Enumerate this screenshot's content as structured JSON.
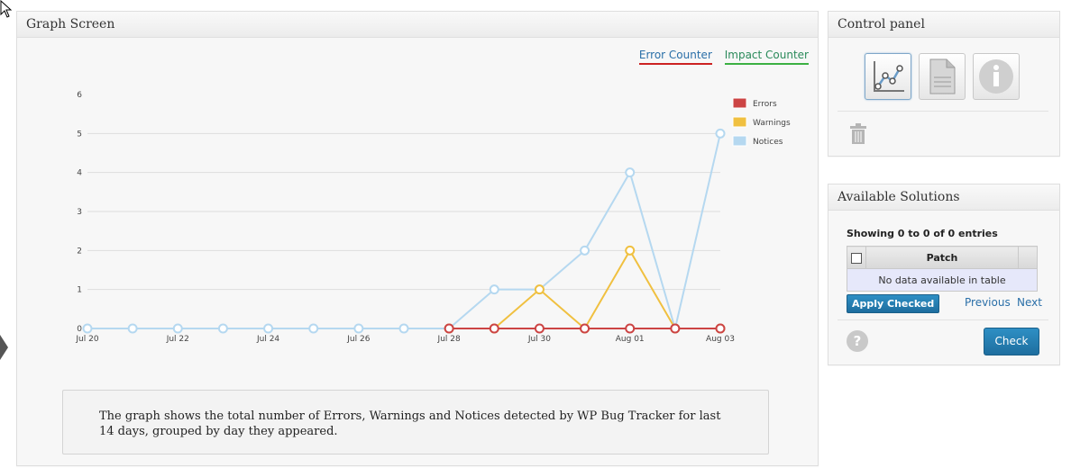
{
  "graph_panel": {
    "title": "Graph Screen",
    "tabs": {
      "error_counter": "Error Counter",
      "impact_counter": "Impact Counter"
    },
    "description": "The graph shows the total number of Errors, Warnings and Notices detected by WP Bug Tracker for last 14 days, grouped by day they appeared."
  },
  "control_panel": {
    "title": "Control panel",
    "icons": [
      "line-chart-icon",
      "document-icon",
      "info-icon",
      "trash-icon"
    ]
  },
  "solutions": {
    "title": "Available Solutions",
    "showing": "Showing 0 to 0 of 0 entries",
    "column": "Patch",
    "empty": "No data available in table",
    "apply": "Apply Checked",
    "previous": "Previous",
    "next": "Next",
    "check": "Check",
    "help_icon": "?"
  },
  "chart_data": {
    "type": "line",
    "x": [
      "Jul 20",
      "Jul 21",
      "Jul 22",
      "Jul 23",
      "Jul 24",
      "Jul 25",
      "Jul 26",
      "Jul 27",
      "Jul 28",
      "Jul 29",
      "Jul 30",
      "Jul 31",
      "Aug 01",
      "Aug 02",
      "Aug 03"
    ],
    "tick_labels": [
      "Jul 20",
      "Jul 22",
      "Jul 24",
      "Jul 26",
      "Jul 28",
      "Jul 30",
      "Aug 01",
      "Aug 03"
    ],
    "y_ticks": [
      0,
      1,
      2,
      3,
      4,
      5,
      6
    ],
    "ylim": [
      0,
      6
    ],
    "grid": true,
    "legend_position": "top-right",
    "series": [
      {
        "name": "Notices",
        "color": "#b5d8f0",
        "start": 0,
        "values": [
          0,
          0,
          0,
          0,
          0,
          0,
          0,
          0,
          0,
          1,
          1,
          2,
          4,
          0,
          5
        ]
      },
      {
        "name": "Warnings",
        "color": "#f0c040",
        "start": 8,
        "values": [
          0,
          0,
          1,
          0,
          2,
          0,
          0
        ]
      },
      {
        "name": "Errors",
        "color": "#cc4444",
        "start": 8,
        "values": [
          0,
          0,
          0,
          0,
          0,
          0,
          0
        ]
      }
    ],
    "legend": [
      "Errors",
      "Warnings",
      "Notices"
    ]
  }
}
